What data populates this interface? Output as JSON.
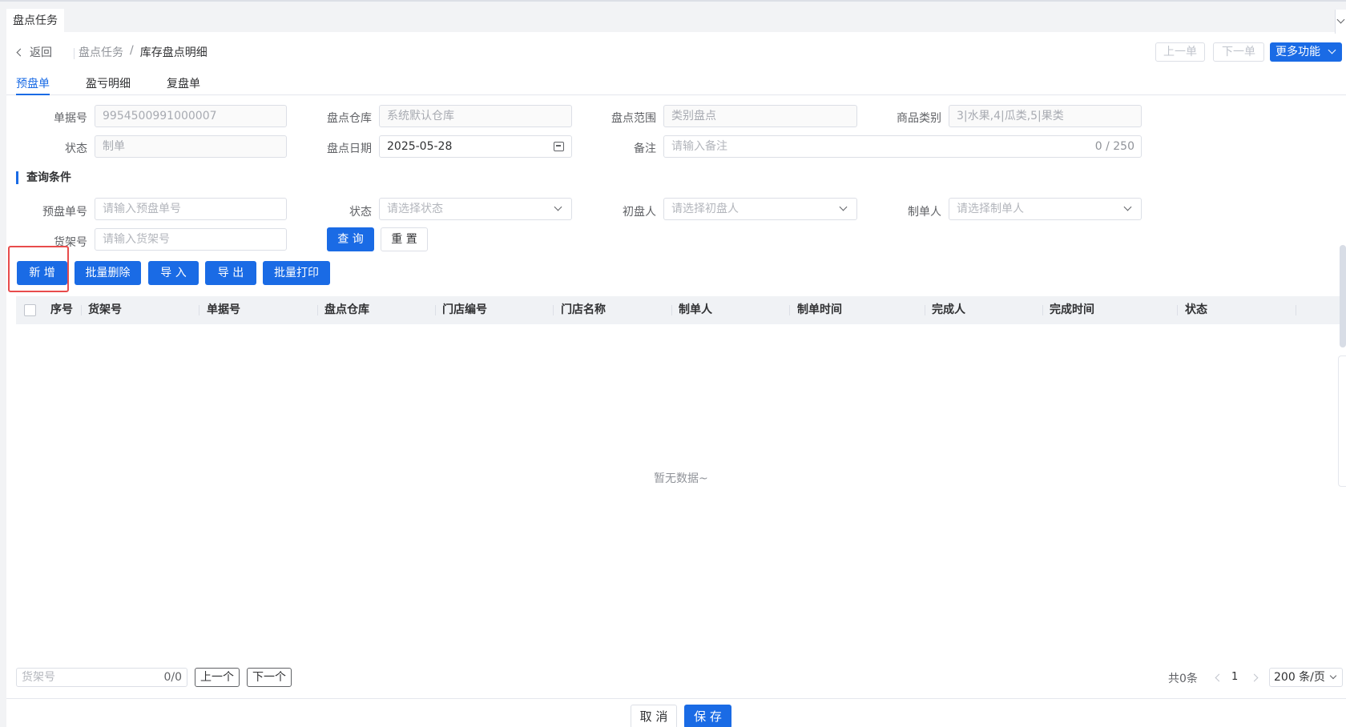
{
  "window": {
    "active_tab": "盘点任务"
  },
  "header": {
    "back_label": "返回",
    "breadcrumb": [
      "盘点任务",
      "/",
      "库存盘点明细"
    ],
    "prev_label": "上一单",
    "next_label": "下一单",
    "more_label": "更多功能"
  },
  "subtabs": [
    "预盘单",
    "盈亏明细",
    "复盘单"
  ],
  "form": {
    "doc_no": {
      "label": "单据号",
      "value": "9954500991000007"
    },
    "warehouse": {
      "label": "盘点仓库",
      "placeholder": "系统默认仓库"
    },
    "range": {
      "label": "盘点范围",
      "value": "类别盘点"
    },
    "category": {
      "label": "商品类别",
      "value": "3|水果,4|瓜类,5|果类"
    },
    "status": {
      "label": "状态",
      "value": "制单"
    },
    "date": {
      "label": "盘点日期",
      "value": "2025-05-28"
    },
    "remark": {
      "label": "备注",
      "placeholder": "请输入备注",
      "counter": "0 / 250"
    }
  },
  "query": {
    "section_title": "查询条件",
    "pre_no": {
      "label": "预盘单号",
      "placeholder": "请输入预盘单号"
    },
    "status": {
      "label": "状态",
      "placeholder": "请选择状态"
    },
    "first_counter": {
      "label": "初盘人",
      "placeholder": "请选择初盘人"
    },
    "maker": {
      "label": "制单人",
      "placeholder": "请选择制单人"
    },
    "shelf": {
      "label": "货架号",
      "placeholder": "请输入货架号"
    },
    "search_label": "查 询",
    "reset_label": "重 置"
  },
  "toolbar": {
    "add_label": "新 增",
    "batch_delete_label": "批量删除",
    "import_label": "导 入",
    "export_label": "导 出",
    "batch_print_label": "批量打印"
  },
  "table": {
    "columns": [
      "序号",
      "货架号",
      "单据号",
      "盘点仓库",
      "门店编号",
      "门店名称",
      "制单人",
      "制单时间",
      "完成人",
      "完成时间",
      "状态"
    ],
    "empty_text": "暂无数据~"
  },
  "bottom": {
    "shelf_placeholder": "货架号",
    "shelf_count": "0/0",
    "prev_label": "上一个",
    "next_label": "下一个"
  },
  "pager": {
    "total": "共0条",
    "page": "1",
    "page_size": "200 条/页"
  },
  "footer": {
    "cancel_label": "取 消",
    "save_label": "保 存"
  },
  "colors": {
    "accent": "#1a6be5",
    "highlight": "#e84c4c"
  }
}
